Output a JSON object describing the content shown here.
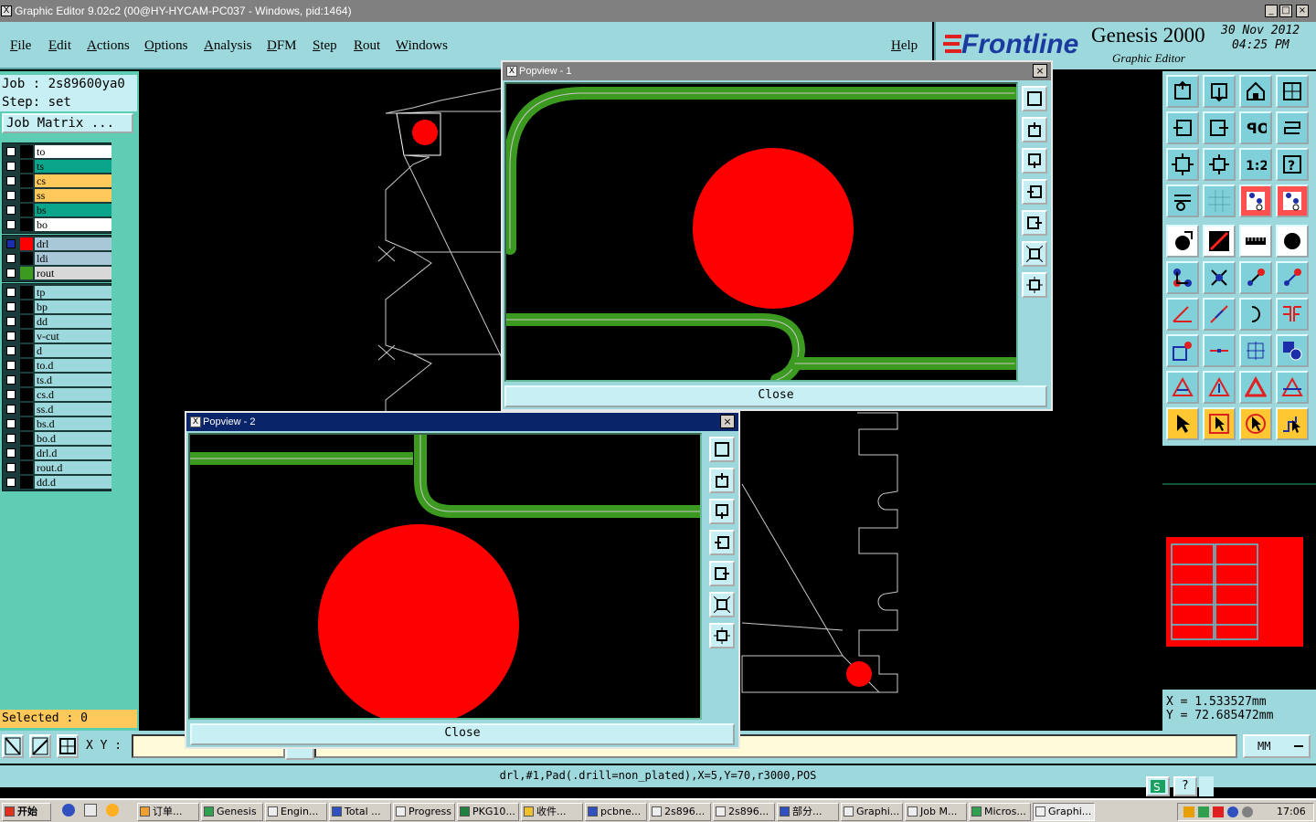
{
  "window": {
    "title": "Graphic Editor 9.02c2 (00@HY-HYCAM-PC037 - Windows, pid:1464)"
  },
  "menu": {
    "items": [
      "File",
      "Edit",
      "Actions",
      "Options",
      "Analysis",
      "DFM",
      "Step",
      "Rout",
      "Windows"
    ],
    "help": "Help"
  },
  "logo": {
    "brand": "Frontline",
    "product": "Genesis 2000",
    "subtitle": "Graphic Editor",
    "date": "30 Nov 2012",
    "time": "04:25 PM"
  },
  "job": {
    "job_label": "Job  : 2s89600ya0",
    "step_label": "Step: set",
    "matrix_button": "Job Matrix ..."
  },
  "layers": {
    "group1": [
      {
        "name": "to",
        "color": "#ffffff"
      },
      {
        "name": "ts",
        "color": "#0aa58a"
      },
      {
        "name": "cs",
        "color": "#ffc85a"
      },
      {
        "name": "ss",
        "color": "#ffc85a"
      },
      {
        "name": "bs",
        "color": "#0aa58a"
      },
      {
        "name": "bo",
        "color": "#ffffff"
      }
    ],
    "group2": [
      {
        "name": "drl",
        "color": "#a8c8d8",
        "swatch": "#ff0000"
      },
      {
        "name": "ldi",
        "color": "#a8c8d8",
        "swatch": "#000000"
      },
      {
        "name": "rout",
        "color": "#d8d8d8",
        "swatch": "#3c9a20"
      }
    ],
    "group3": [
      "tp",
      "bp",
      "dd",
      "v-cut",
      "d",
      "to.d",
      "ts.d",
      "cs.d",
      "ss.d",
      "bs.d",
      "bo.d",
      "drl.d",
      "rout.d",
      "dd.d"
    ]
  },
  "selected": "Selected : 0",
  "coords": {
    "x": "X  =  1.533527mm",
    "y": "Y  =  72.685472mm"
  },
  "units": "MM",
  "xy_label": "X Y :",
  "status": "drl,#1,Pad(.drill=non_plated),X=5,Y=70,r3000,POS",
  "popups": [
    {
      "title": "Popview - 1",
      "close_label": "Close"
    },
    {
      "title": "Popview - 2",
      "close_label": "Close"
    }
  ],
  "taskbar": {
    "start": "开始",
    "clock": "17:06",
    "tasks": [
      "订单...",
      "Genesis",
      "Engin...",
      "Total ...",
      "Progress",
      "PKG10...",
      "收件...",
      "pcbne...",
      "2s896...",
      "2s896...",
      "部分...",
      "Graphi...",
      "Job M...",
      "Micros...",
      "Graphi..."
    ]
  },
  "colors": {
    "teal_panel": "#9cd8dc",
    "left_panel": "#5fcdb4",
    "pad_red": "#ff0000",
    "rout_green": "#3c9a20"
  }
}
